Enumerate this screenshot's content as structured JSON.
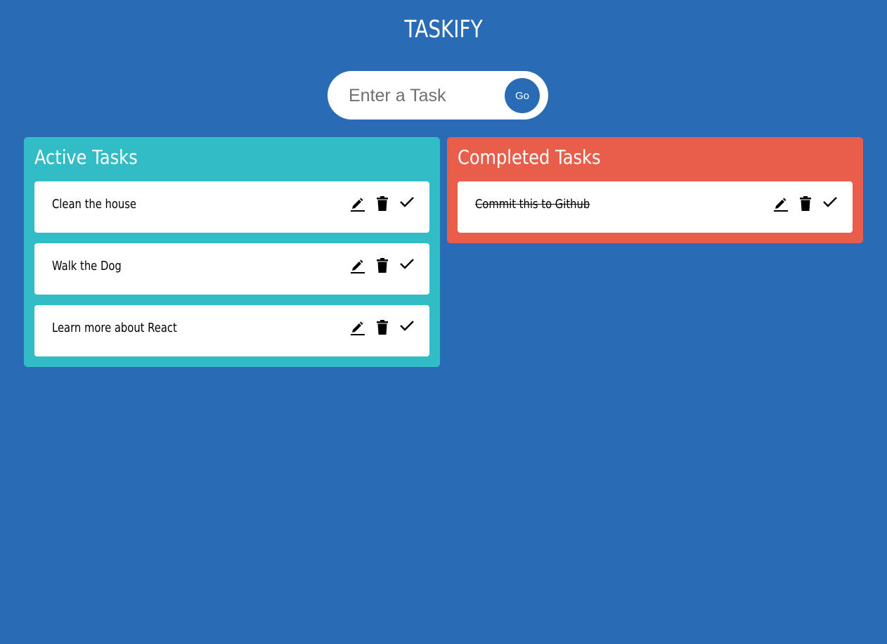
{
  "app": {
    "title": "TASKIFY"
  },
  "search": {
    "placeholder": "Enter a Task",
    "value": "",
    "submit_label": "Go"
  },
  "active": {
    "heading": "Active Tasks",
    "tasks": [
      {
        "text": "Clean the house"
      },
      {
        "text": "Walk the Dog"
      },
      {
        "text": "Learn more about React"
      }
    ]
  },
  "completed": {
    "heading": "Completed Tasks",
    "tasks": [
      {
        "text": "Commit this to Github"
      }
    ]
  },
  "icons": {
    "edit": "pencil-icon",
    "delete": "trash-icon",
    "done": "check-icon"
  },
  "colors": {
    "background": "#2a6bb5",
    "active_column": "#32bcc6",
    "completed_column": "#e95e4b",
    "card": "#ffffff"
  }
}
